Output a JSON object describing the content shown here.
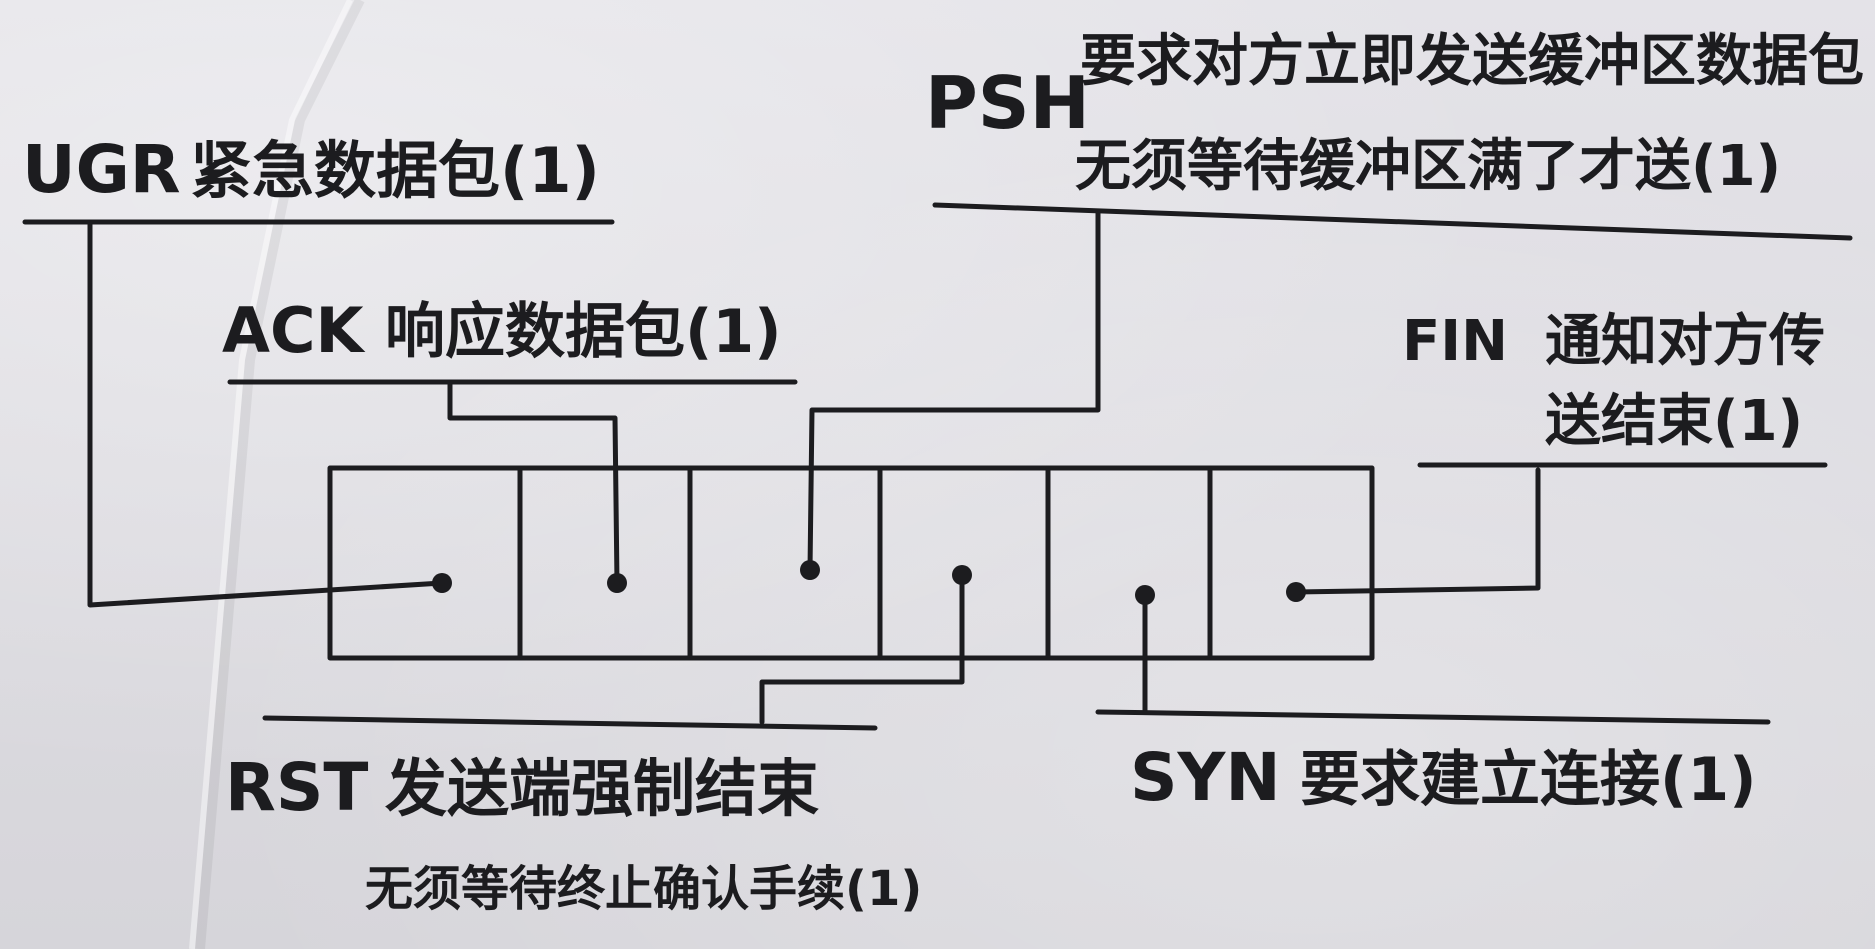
{
  "flags": {
    "urg": {
      "name": "UGR",
      "desc": "紧急数据包(1)"
    },
    "ack": {
      "name": "ACK",
      "desc": "响应数据包(1)"
    },
    "psh": {
      "name": "PSH",
      "line1": "要求对方立即发送缓冲区数据包",
      "line2": "无须等待缓冲区满了才送(1)"
    },
    "fin": {
      "name": "FIN",
      "line1": "通知对方传",
      "line2": "送结束(1)"
    },
    "rst": {
      "name": "RST",
      "line1": "发送端强制结束",
      "line2": "无须等待终止确认手续(1)"
    },
    "syn": {
      "name": "SYN",
      "desc": "要求建立连接(1)"
    }
  },
  "colors": {
    "ink": "#1c1c1f",
    "paper": "#dcdbe0"
  }
}
